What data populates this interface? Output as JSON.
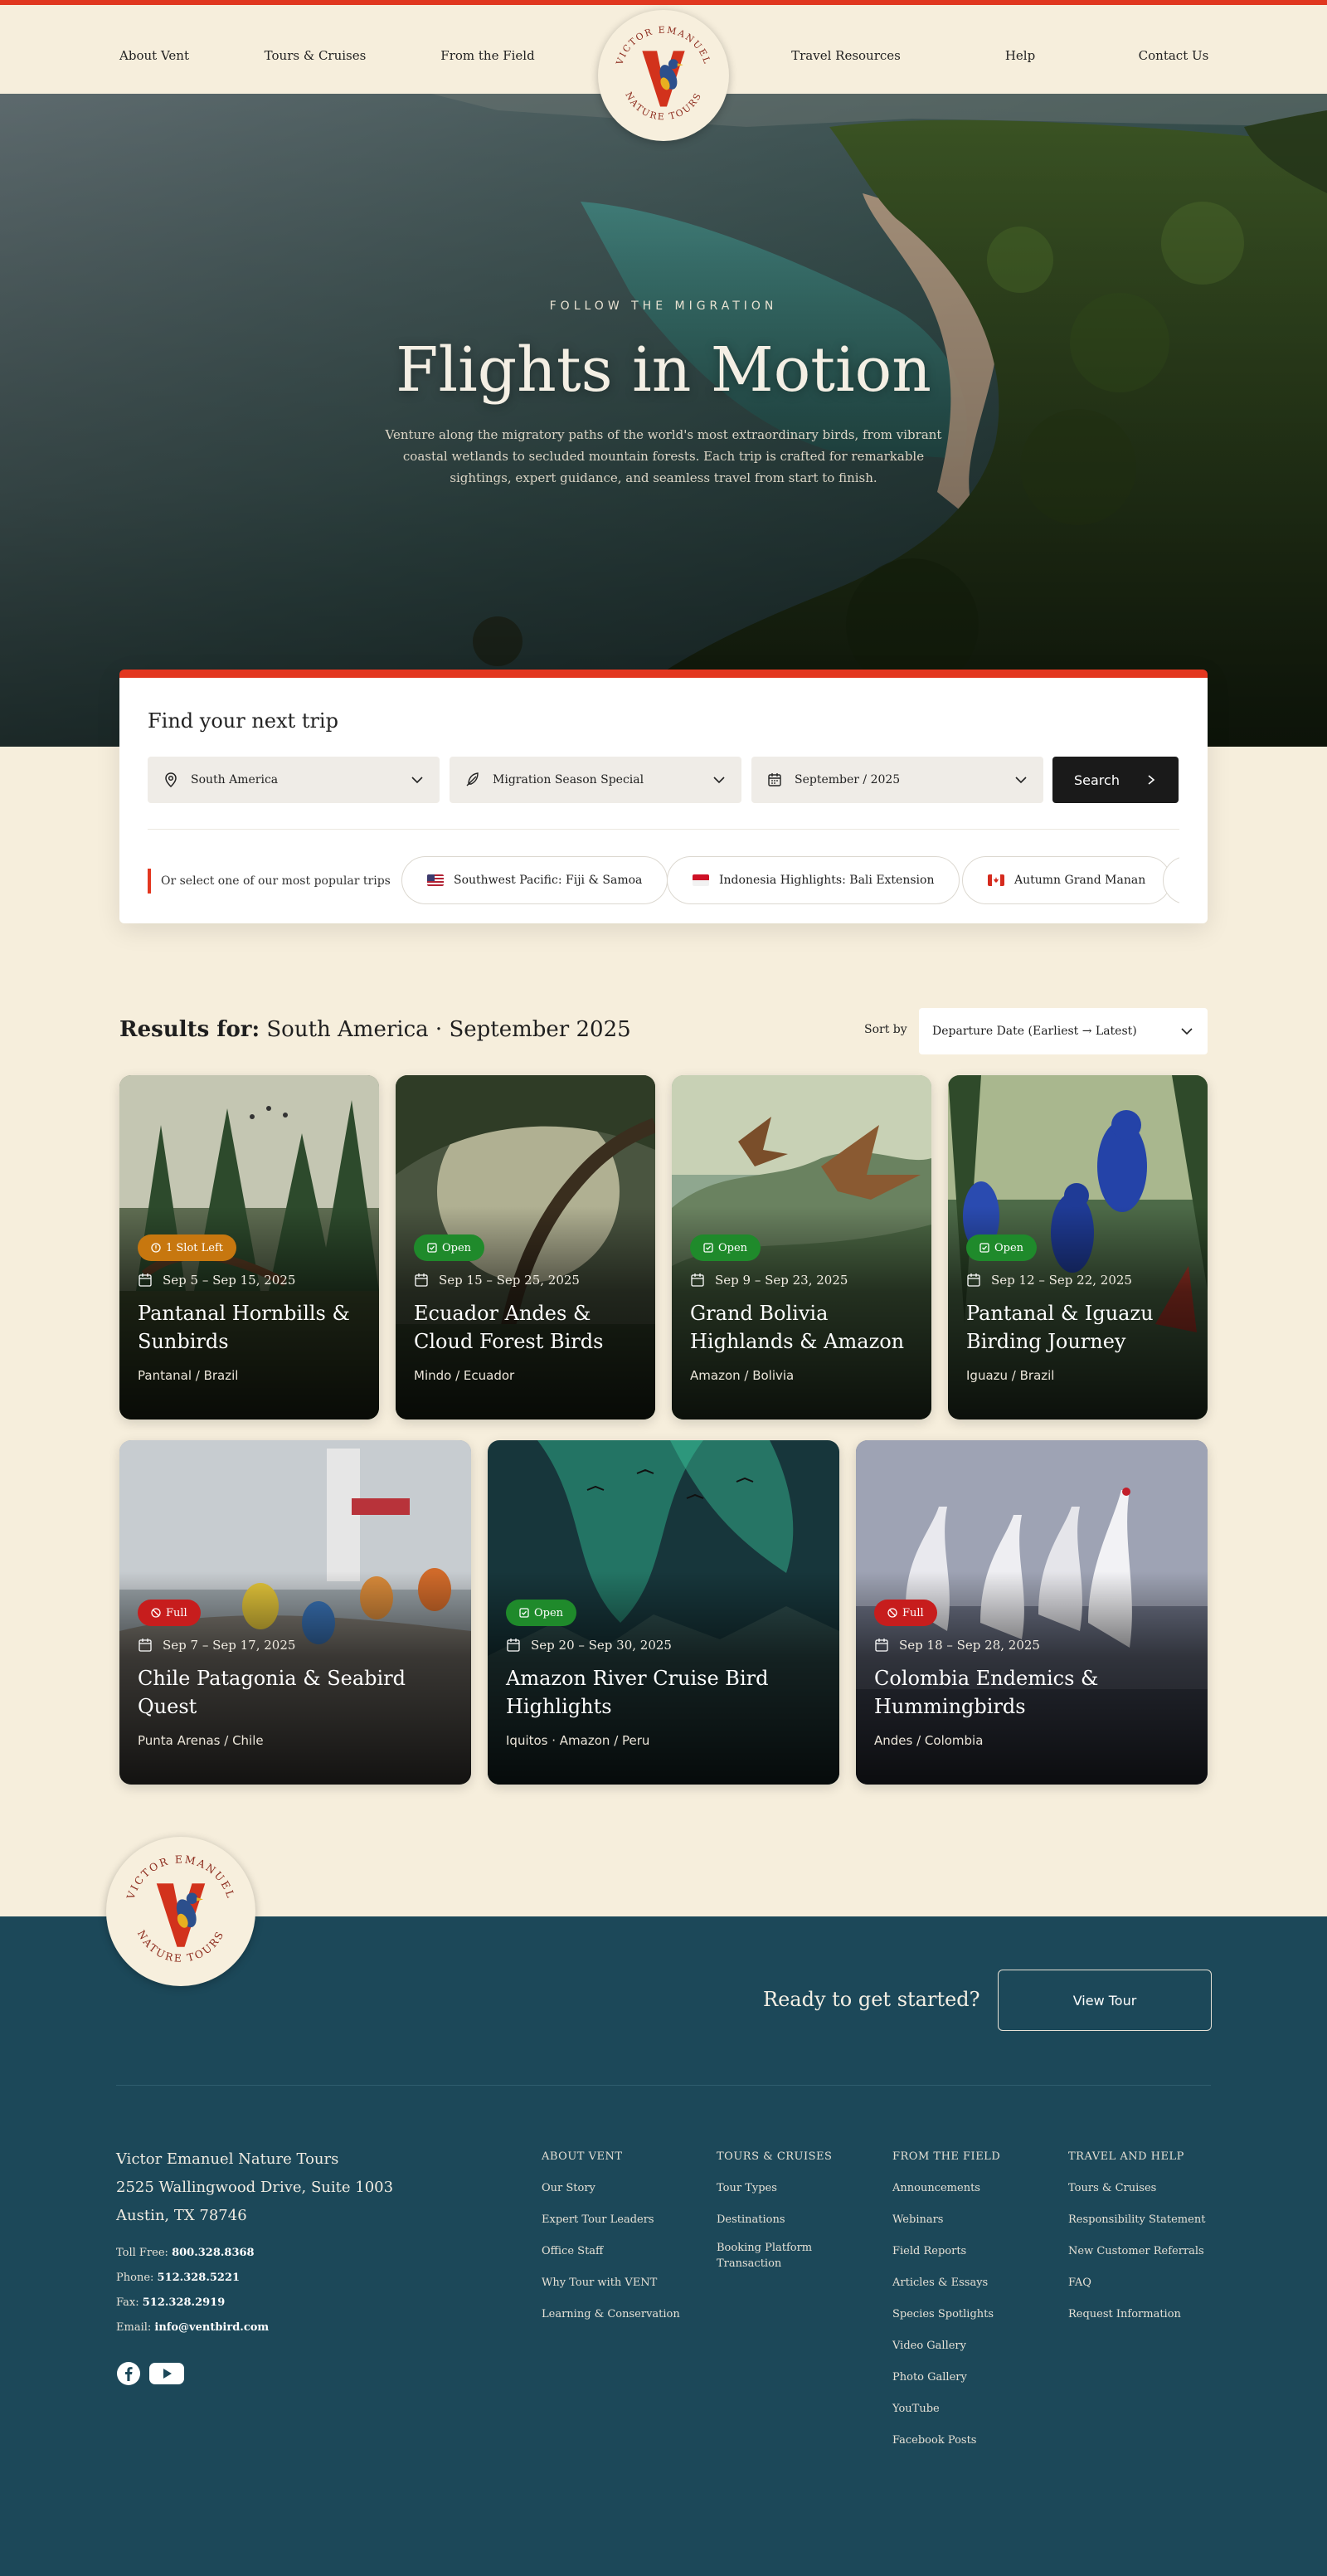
{
  "nav": {
    "left": [
      "About Vent",
      "Tours & Cruises",
      "From the Field"
    ],
    "right": [
      "Travel Resources",
      "Help",
      "Contact Us"
    ],
    "logo": {
      "top_text": "VICTOR EMANUEL",
      "bottom_text": "NATURE TOURS",
      "letter": "V"
    }
  },
  "hero": {
    "eyebrow": "FOLLOW THE MIGRATION",
    "title": "Flights in Motion",
    "subtitle": "Venture along the migratory paths of the world's most extraordinary birds, from vibrant coastal wetlands to secluded mountain forests. Each trip is crafted for remarkable sightings, expert guidance, and seamless travel from start to finish."
  },
  "search": {
    "title": "Find your next trip",
    "region": "South America",
    "tour_type": "Migration Season Special",
    "month": "September / 2025",
    "button": "Search",
    "popular_label": "Or select one of our most popular trips",
    "popular": [
      {
        "label": "Southwest Pacific: Fiji & Samoa",
        "flag": "us"
      },
      {
        "label": "Indonesia Highlights: Bali Extension",
        "flag": "id"
      },
      {
        "label": "Autumn Grand Manan",
        "flag": "ca"
      },
      {
        "label": "",
        "flag": "us"
      }
    ]
  },
  "results": {
    "prefix": "Results for:",
    "query": "South America · September 2025",
    "sort_label": "Sort by",
    "sort_value": "Departure Date (Earliest → Latest)"
  },
  "cards": [
    {
      "status": "1 Slot Left",
      "status_color": "#c7770f",
      "dates": "Sep 5 – Sep 15, 2025",
      "title": "Pantanal Hornbills & Sunbirds",
      "location": "Pantanal / Brazil"
    },
    {
      "status": "Open",
      "status_color": "#1f8a2b",
      "dates": "Sep 15 – Sep 25, 2025",
      "title": "Ecuador Andes & Cloud Forest Birds",
      "location": "Mindo / Ecuador"
    },
    {
      "status": "Open",
      "status_color": "#1f8a2b",
      "dates": "Sep 9 – Sep 23, 2025",
      "title": "Grand Bolivia Highlands & Amazon",
      "location": "Amazon / Bolivia"
    },
    {
      "status": "Open",
      "status_color": "#1f8a2b",
      "dates": "Sep 12 – Sep 22, 2025",
      "title": "Pantanal & Iguazu Birding Journey",
      "location": "Iguazu / Brazil"
    },
    {
      "status": "Full",
      "status_color": "#c71d1d",
      "dates": "Sep 7 – Sep 17, 2025",
      "title": "Chile Patagonia & Seabird Quest",
      "location": "Punta Arenas / Chile"
    },
    {
      "status": "Open",
      "status_color": "#1f8a2b",
      "dates": "Sep 20 – Sep 30, 2025",
      "title": "Amazon River Cruise Bird Highlights",
      "location": "Iquitos · Amazon / Peru"
    },
    {
      "status": "Full",
      "status_color": "#c71d1d",
      "dates": "Sep 18 – Sep 28, 2025",
      "title": "Colombia Endemics & Hummingbirds",
      "location": "Andes / Colombia"
    }
  ],
  "footer": {
    "cta_text": "Ready to get started?",
    "cta_button": "View Tour",
    "company": "Victor Emanuel Nature Tours",
    "address1": "2525 Wallingwood Drive, Suite 1003",
    "address2": "Austin, TX 78746",
    "toll_free_label": "Toll Free:",
    "toll_free": "800.328.8368",
    "phone_label": "Phone:",
    "phone": "512.328.5221",
    "fax_label": "Fax:",
    "fax": "512.328.2919",
    "email_label": "Email:",
    "email": "info@ventbird.com",
    "columns": [
      {
        "head": "ABOUT VENT",
        "links": [
          "Our Story",
          "Expert Tour Leaders",
          "Office Staff",
          "Why Tour with VENT",
          "Learning & Conservation"
        ]
      },
      {
        "head": "TOURS & CRUISES",
        "links": [
          "Tour Types",
          "Destinations",
          "Booking Platform Transaction"
        ]
      },
      {
        "head": "FROM THE FIELD",
        "links": [
          "Announcements",
          "Webinars",
          "Field Reports",
          "Articles & Essays",
          "Species Spotlights",
          "Video Gallery",
          "Photo Gallery",
          "YouTube",
          "Facebook Posts"
        ]
      },
      {
        "head": "TRAVEL AND HELP",
        "links": [
          "Tours & Cruises",
          "Responsibility Statement",
          "New Customer Referrals",
          "FAQ",
          "Request Information"
        ]
      }
    ]
  },
  "colors": {
    "accent": "#e3371f",
    "footer": "#1c4859",
    "page": "#f6eedc"
  }
}
